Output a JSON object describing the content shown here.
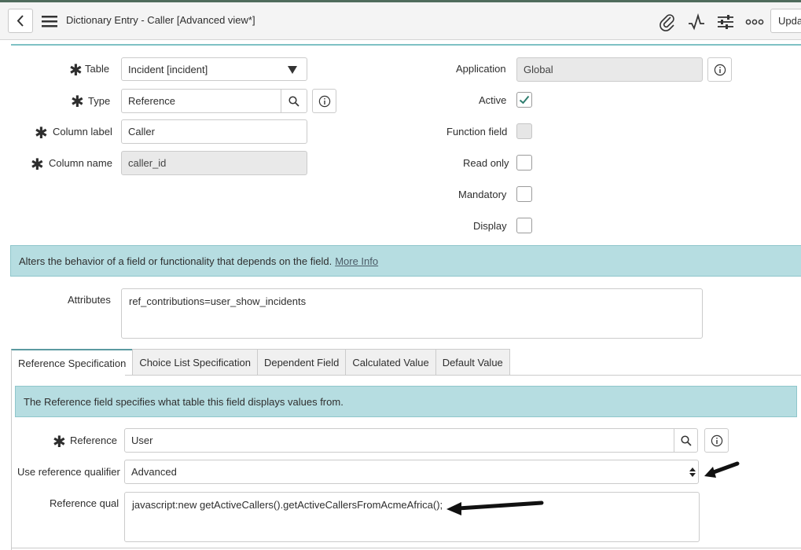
{
  "header": {
    "title": "Dictionary Entry - Caller [Advanced view*]",
    "update_label": "Upda",
    "icons": [
      "paperclip-icon",
      "activity-icon",
      "sliders-icon",
      "more-icon"
    ]
  },
  "form": {
    "table": {
      "label": "Table",
      "value": "Incident [incident]"
    },
    "type": {
      "label": "Type",
      "value": "Reference"
    },
    "column_label": {
      "label": "Column label",
      "value": "Caller"
    },
    "column_name": {
      "label": "Column name",
      "value": "caller_id"
    },
    "application": {
      "label": "Application",
      "value": "Global"
    },
    "active": {
      "label": "Active",
      "checked": true
    },
    "function_field": {
      "label": "Function field",
      "checked": false
    },
    "read_only": {
      "label": "Read only",
      "checked": false
    },
    "mandatory": {
      "label": "Mandatory",
      "checked": false
    },
    "display": {
      "label": "Display",
      "checked": false
    }
  },
  "info_banner": {
    "text": "Alters the behavior of a field or functionality that depends on the field.",
    "link": "More Info"
  },
  "attributes": {
    "label": "Attributes",
    "value": "ref_contributions=user_show_incidents"
  },
  "tabs": [
    {
      "label": "Reference Specification",
      "active": true
    },
    {
      "label": "Choice List Specification",
      "active": false
    },
    {
      "label": "Dependent Field",
      "active": false
    },
    {
      "label": "Calculated Value",
      "active": false
    },
    {
      "label": "Default Value",
      "active": false
    }
  ],
  "reference_spec": {
    "banner": "The Reference field specifies what table this field displays values from.",
    "reference": {
      "label": "Reference",
      "value": "User"
    },
    "qualifier": {
      "label": "Use reference qualifier",
      "value": "Advanced"
    },
    "ref_qual": {
      "label": "Reference qual",
      "value": "javascript:new getActiveCallers().getActiveCallersFromAcmeAfrica();"
    }
  }
}
